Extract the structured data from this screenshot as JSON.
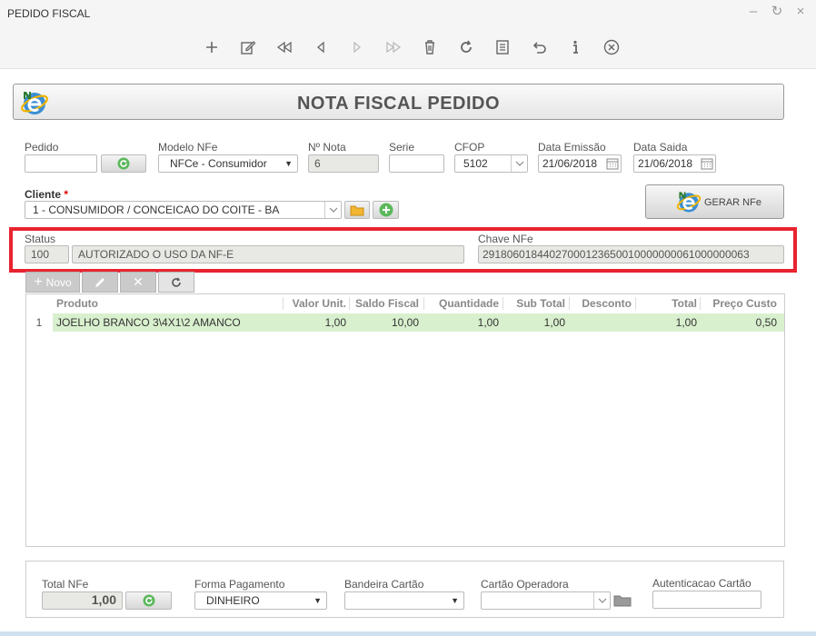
{
  "window": {
    "title": "PEDIDO FISCAL"
  },
  "header": {
    "title": "NOTA FISCAL PEDIDO"
  },
  "form": {
    "pedido_label": "Pedido",
    "pedido_value": "",
    "modelo_label": "Modelo NFe",
    "modelo_value": "NFCe - Consumidor",
    "nota_label": "Nº Nota",
    "nota_value": "6",
    "serie_label": "Serie",
    "serie_value": "",
    "cfop_label": "CFOP",
    "cfop_value": "5102",
    "emissao_label": "Data Emissão",
    "emissao_value": "21/06/2018",
    "saida_label": "Data Saida",
    "saida_value": "21/06/2018",
    "cliente_label": "Cliente",
    "cliente_required": "*",
    "cliente_value": "1 - CONSUMIDOR / CONCEICAO DO COITE - BA",
    "gerar_label": "GERAR NFe"
  },
  "status": {
    "status_label": "Status",
    "code": "100",
    "text": "AUTORIZADO O USO DA NF-E",
    "chave_label": "Chave NFe",
    "chave_value": "29180601844027000123650010000000061000000063"
  },
  "grid_toolbar": {
    "novo_label": "Novo"
  },
  "grid": {
    "columns": [
      "Produto",
      "Valor Unit.",
      "Saldo Fiscal",
      "Quantidade",
      "Sub Total",
      "Desconto",
      "Total",
      "Preço Custo"
    ],
    "rows": [
      {
        "n": "1",
        "produto": "JOELHO BRANCO 3\\4X1\\2 AMANCO",
        "valor_unit": "1,00",
        "saldo_fiscal": "10,00",
        "quantidade": "1,00",
        "sub_total": "1,00",
        "desconto": "",
        "total": "1,00",
        "preco_custo": "0,50"
      }
    ]
  },
  "footer": {
    "total_label": "Total NFe",
    "total_value": "1,00",
    "forma_label": "Forma Pagamento",
    "forma_value": "DINHEIRO",
    "bandeira_label": "Bandeira Cartão",
    "bandeira_value": "",
    "operadora_label": "Cartão Operadora",
    "operadora_value": "",
    "autent_label": "Autenticacao Cartão",
    "autent_value": ""
  },
  "colors": {
    "highlight": "#e8232f",
    "row_selected": "#d9f0ce",
    "accent_green": "#5cb85c"
  }
}
